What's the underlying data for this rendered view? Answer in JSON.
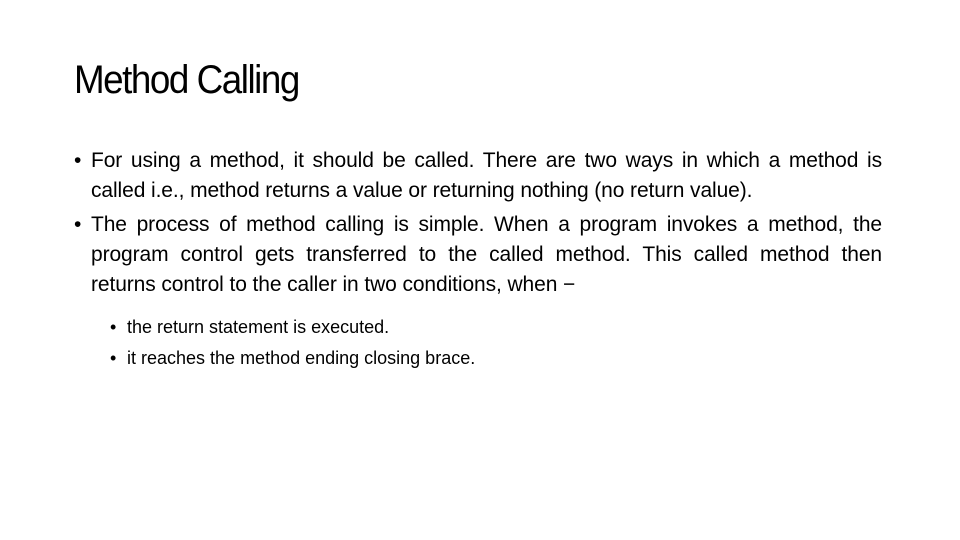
{
  "slide": {
    "title": "Method Calling",
    "bullet_glyph": "•",
    "bullets": [
      {
        "text": "For using a method, it should be called. There are two ways in which a method is called i.e., method returns a value or returning nothing (no return value)."
      },
      {
        "text": "The process of method calling is simple. When a program invokes a method, the program control gets transferred to the called method. This called method then returns control to the caller in two conditions, when −"
      }
    ],
    "sub_bullets": [
      {
        "text": "the return statement is executed."
      },
      {
        "text": "it reaches the method ending closing brace."
      }
    ]
  }
}
